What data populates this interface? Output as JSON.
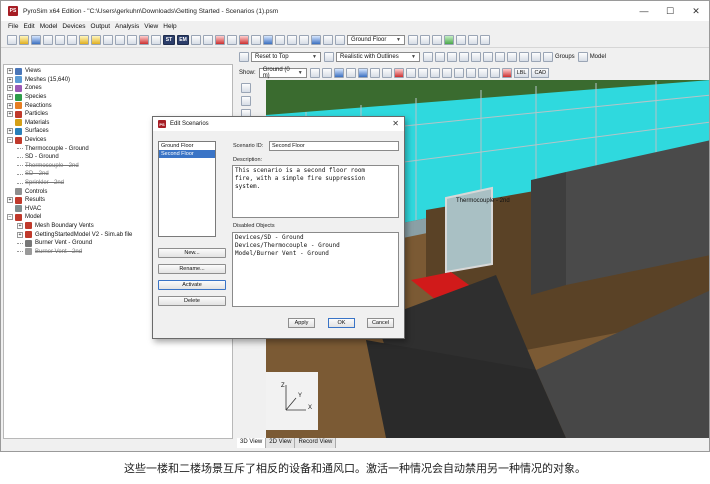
{
  "window": {
    "title": "PyroSim x64 Edition - \"C:\\Users\\gerkuhn\\Downloads\\Getting Started - Scenarios (1).psm",
    "app_icon": "PS",
    "minimize": "—",
    "maximize": "☐",
    "close": "✕"
  },
  "menu": [
    "File",
    "Edit",
    "Model",
    "Devices",
    "Output",
    "Analysis",
    "View",
    "Help"
  ],
  "toolbar": {
    "st_label": "ST",
    "em_label": "EM",
    "floor_dropdown": "Ground Floor",
    "group_label": "Groups",
    "model_label": "Model"
  },
  "toolbar2": {
    "reset_dropdown": "Reset to Top",
    "render_dropdown": "Realistic with Outlines"
  },
  "toolbar3": {
    "show_label": "Show:",
    "show_dropdown": "Ground (0 m)",
    "lbl_button": "LBL",
    "cad_button": "CAD"
  },
  "tree": [
    {
      "label": "Views",
      "expander": "+",
      "icon": "views-icon",
      "color": "#4a76b8",
      "indent": 0,
      "strike": false
    },
    {
      "label": "Meshes (15,640)",
      "expander": "+",
      "icon": "mesh-icon",
      "color": "#5b9bd5",
      "indent": 0,
      "strike": false
    },
    {
      "label": "Zones",
      "expander": "+",
      "icon": "zones-icon",
      "color": "#9b59b6",
      "indent": 0,
      "strike": false
    },
    {
      "label": "Species",
      "expander": "+",
      "icon": "species-icon",
      "color": "#2e9c4a",
      "indent": 0,
      "strike": false
    },
    {
      "label": "Reactions",
      "expander": "+",
      "icon": "reaction-icon",
      "color": "#e67e22",
      "indent": 0,
      "strike": false
    },
    {
      "label": "Particles",
      "expander": "+",
      "icon": "particle-icon",
      "color": "#c0392b",
      "indent": 0,
      "strike": false
    },
    {
      "label": "Materials",
      "expander": "",
      "icon": "material-icon",
      "color": "#d4a017",
      "indent": 0,
      "strike": false
    },
    {
      "label": "Surfaces",
      "expander": "+",
      "icon": "surface-icon",
      "color": "#2980b9",
      "indent": 0,
      "strike": false
    },
    {
      "label": "Devices",
      "expander": "−",
      "icon": "device-icon",
      "color": "#c0392b",
      "indent": 0,
      "strike": false
    },
    {
      "label": "Thermocouple - Ground",
      "expander": "",
      "icon": "",
      "color": "",
      "indent": 1,
      "strike": false
    },
    {
      "label": "SD - Ground",
      "expander": "",
      "icon": "",
      "color": "",
      "indent": 1,
      "strike": false
    },
    {
      "label": "Thermocouple - 2nd",
      "expander": "",
      "icon": "",
      "color": "",
      "indent": 1,
      "strike": true
    },
    {
      "label": "SD - 2nd",
      "expander": "",
      "icon": "",
      "color": "",
      "indent": 1,
      "strike": true
    },
    {
      "label": "Sprinkler - 2nd",
      "expander": "",
      "icon": "",
      "color": "",
      "indent": 1,
      "strike": true
    },
    {
      "label": "Controls",
      "expander": "",
      "icon": "controls-icon",
      "color": "#8e8e8e",
      "indent": 0,
      "strike": false
    },
    {
      "label": "Results",
      "expander": "+",
      "icon": "results-icon",
      "color": "#c0392b",
      "indent": 0,
      "strike": false
    },
    {
      "label": "HVAC",
      "expander": "",
      "icon": "hvac-icon",
      "color": "#7f8c8d",
      "indent": 0,
      "strike": false
    },
    {
      "label": "Model",
      "expander": "−",
      "icon": "model-icon",
      "color": "#c0392b",
      "indent": 0,
      "strike": false
    },
    {
      "label": "Mesh Boundary Vents",
      "expander": "+",
      "icon": "vent-icon",
      "color": "#c0392b",
      "indent": 1,
      "strike": false
    },
    {
      "label": "GettingStartedModel V2 - Sim.ab file",
      "expander": "+",
      "icon": "obstruction-icon",
      "color": "#c0392b",
      "indent": 1,
      "strike": false
    },
    {
      "label": "Burner Vent - Ground",
      "expander": "",
      "icon": "burner-icon",
      "color": "#777777",
      "indent": 1,
      "strike": false
    },
    {
      "label": "Burner Vent - 2nd",
      "expander": "",
      "icon": "burner-icon",
      "color": "#999999",
      "indent": 1,
      "strike": true
    }
  ],
  "dialog": {
    "title": "Edit Scenarios",
    "scenarios": [
      {
        "name": "Ground Floor",
        "selected": false
      },
      {
        "name": "Second Floor",
        "selected": true
      }
    ],
    "scenario_id_label": "Scenario ID:",
    "scenario_id_value": "Second Floor",
    "description_label": "Description:",
    "description_value": "This scenario is a second floor room\nfire, with a simple fire suppression\nsystem.",
    "disabled_label": "Disabled Objects",
    "disabled_value": "Devices/SD - Ground\nDevices/Thermocouple - Ground\nModel/Burner Vent - Ground",
    "new_button": "New...",
    "rename_button": "Rename...",
    "activate_button": "Activate",
    "delete_button": "Delete",
    "apply_button": "Apply",
    "ok_button": "OK",
    "cancel_button": "Cancel"
  },
  "view3d": {
    "device_label": "Thermocouple - 2nd",
    "axis_z": "Z",
    "axis_y": "Y",
    "axis_x": "X"
  },
  "status_tabs": {
    "tab_3d": "3D View",
    "tab_2d": "2D View",
    "tab_record": "Record View"
  },
  "caption": "这些一楼和二楼场景互斥了相反的设备和通风口。激活一种情况会自动禁用另一种情况的对象。"
}
